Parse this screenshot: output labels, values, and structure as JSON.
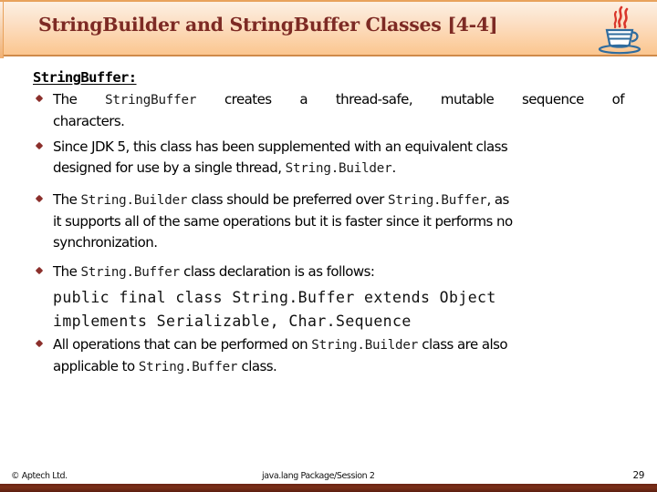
{
  "header": {
    "title": "StringBuilder and StringBuffer Classes [4-4]",
    "logo_icon": "java-cup-logo-icon",
    "bg_top_color": "#fdf0e3",
    "bg_bottom_color": "#fbc68f",
    "title_color": "#7d2a24",
    "border_color": "#cf8a4a"
  },
  "body": {
    "section_heading": "StringBuffer:",
    "bullet_marker_icon": "diamond-bullet-icon",
    "bullet_color": "#8b2f2b",
    "bullets": [
      {
        "id": "bullet-thread-safe",
        "lines": [
          [
            {
              "t": "The ",
              "k": "plain"
            },
            {
              "t": "StringBuffer",
              "k": "code"
            },
            {
              "t": " creates a thread-safe, mutable sequence of",
              "k": "plain"
            }
          ],
          [
            {
              "t": "characters.",
              "k": "plain"
            }
          ]
        ],
        "justified": true
      },
      {
        "id": "bullet-jdk5",
        "lines": [
          [
            {
              "t": "Since JDK 5, this class has been supplemented with an equivalent class",
              "k": "plain"
            }
          ],
          [
            {
              "t": "designed for use by a single thread, ",
              "k": "plain"
            },
            {
              "t": "String.Builder",
              "k": "code"
            },
            {
              "t": ".",
              "k": "plain"
            }
          ]
        ],
        "justified": false
      },
      {
        "id": "bullet-preferred",
        "lines": [
          [
            {
              "t": "The ",
              "k": "plain"
            },
            {
              "t": "String.Builder",
              "k": "code"
            },
            {
              "t": " class should be preferred over ",
              "k": "plain"
            },
            {
              "t": "String.Buffer",
              "k": "code"
            },
            {
              "t": ", as",
              "k": "plain"
            }
          ],
          [
            {
              "t": "it supports all of the same operations but it is faster since it performs no",
              "k": "plain"
            }
          ],
          [
            {
              "t": "synchronization.",
              "k": "plain"
            }
          ]
        ],
        "justified": false
      },
      {
        "id": "bullet-declaration",
        "lines": [
          [
            {
              "t": "The ",
              "k": "plain"
            },
            {
              "t": "String.Buffer",
              "k": "code"
            },
            {
              "t": " class declaration is as follows:",
              "k": "plain"
            }
          ]
        ],
        "justified": false
      },
      {
        "id": "bullet-all-operations",
        "lines": [
          [
            {
              "t": "All operations that can be performed on ",
              "k": "plain"
            },
            {
              "t": "String.Builder",
              "k": "code"
            },
            {
              "t": " class are also",
              "k": "plain"
            }
          ],
          [
            {
              "t": "applicable to ",
              "k": "plain"
            },
            {
              "t": "String.Buffer",
              "k": "code"
            },
            {
              "t": " class.",
              "k": "plain"
            }
          ]
        ],
        "justified": false
      }
    ],
    "code_declaration": {
      "line1": "public final class String.Buffer extends Object",
      "line2": "implements Serializable, Char.Sequence"
    }
  },
  "footer": {
    "copyright": "© Aptech Ltd.",
    "center": "java.lang Package/Session 2",
    "page_number": "29",
    "bar_color": "#6b2414"
  }
}
